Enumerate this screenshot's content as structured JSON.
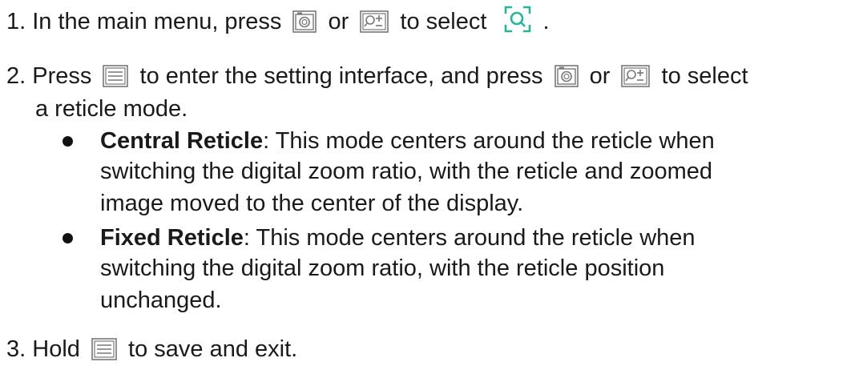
{
  "step1": {
    "number": "1.",
    "text_a": "In the main menu, press",
    "icon_1": "camera-icon",
    "or": "or",
    "icon_2": "zoom-plus-icon",
    "text_b": "to select",
    "icon_3": "reticle-icon",
    "end": "."
  },
  "step2": {
    "number": "2.",
    "text_a": "Press",
    "icon_1": "menu-icon",
    "text_b": "to enter the setting interface, and press",
    "icon_2": "camera-icon",
    "or": "or",
    "icon_3": "zoom-plus-icon",
    "text_c": "to select",
    "line2": "a reticle mode.",
    "bullets": [
      {
        "term": "Central Reticle",
        "lines": [
          ": This mode centers around the reticle when",
          "switching the digital zoom ratio, with the reticle and zoomed",
          "image moved to the center of the display."
        ]
      },
      {
        "term": "Fixed Reticle",
        "lines": [
          ": This mode centers around the reticle when",
          "switching the digital zoom ratio, with the reticle position",
          "unchanged."
        ]
      }
    ]
  },
  "step3": {
    "number": "3.",
    "text_a": "Hold",
    "icon_1": "menu-icon",
    "text_b": "to save and exit."
  },
  "colors": {
    "text": "#1a1a1a",
    "accent": "#1fb89a"
  }
}
